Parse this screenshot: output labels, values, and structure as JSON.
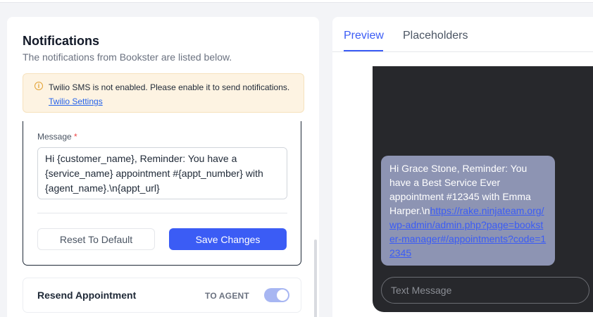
{
  "notifications": {
    "title": "Notifications",
    "subtitle": "The notifications from Bookster are listed below."
  },
  "alert": {
    "icon": "info-icon",
    "text": "Twilio SMS is not enabled. Please enable it to send notifications.",
    "link_label": "Twilio Settings"
  },
  "message": {
    "label": "Message",
    "required_mark": "*",
    "value": "Hi {customer_name}, Reminder: You have a {service_name} appointment #{appt_number} with {agent_name}.\\n{appt_url}"
  },
  "buttons": {
    "reset_label": "Reset To Default",
    "save_label": "Save Changes"
  },
  "resend": {
    "label": "Resend Appointment",
    "to_label": "TO AGENT",
    "toggle_on": true
  },
  "preview": {
    "tabs": [
      {
        "label": "Preview",
        "active": true
      },
      {
        "label": "Placeholders",
        "active": false
      }
    ],
    "bubble_text": "Hi Grace Stone, Reminder: You have a Best Service Ever appointment #12345 with Emma Harper.\\n",
    "bubble_link": "https://rake.ninjateam.org/wp-admin/admin.php?page=bookster-manager#/appointments?code=12345",
    "input_placeholder": "Text Message"
  },
  "colors": {
    "accent": "#3b5cf5",
    "alert_bg": "#fdf3e2",
    "alert_icon": "#e3a234",
    "phone_bg": "#27282c",
    "bubble_bg": "#8d94b3"
  }
}
